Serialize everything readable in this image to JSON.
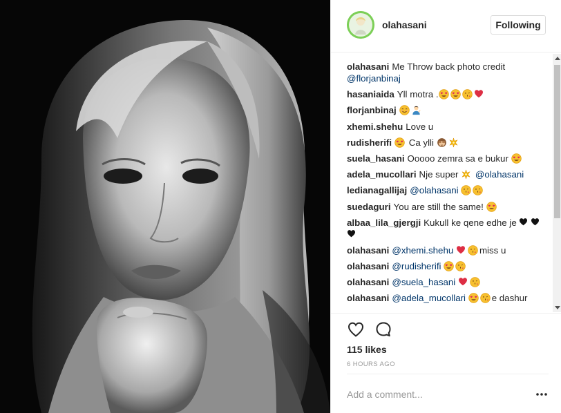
{
  "header": {
    "username": "olahasani",
    "follow_label": "Following"
  },
  "comments": [
    {
      "user": "olahasani",
      "parts": [
        {
          "t": "text",
          "v": "Me Throw back photo credit "
        },
        {
          "t": "mention",
          "v": "@florjanbinaj"
        }
      ]
    },
    {
      "user": "hasaniaida",
      "parts": [
        {
          "t": "text",
          "v": "Yll motra ."
        },
        {
          "t": "emoji",
          "v": "heart-eyes"
        },
        {
          "t": "emoji",
          "v": "heart-eyes"
        },
        {
          "t": "emoji",
          "v": "kiss"
        },
        {
          "t": "emoji",
          "v": "heart"
        }
      ]
    },
    {
      "user": "florjanbinaj",
      "parts": [
        {
          "t": "emoji",
          "v": "smile"
        },
        {
          "t": "emoji",
          "v": "person-tipping-hand"
        }
      ]
    },
    {
      "user": "xhemi.shehu",
      "parts": [
        {
          "t": "text",
          "v": "Love u"
        }
      ]
    },
    {
      "user": "rudisherifi",
      "parts": [
        {
          "t": "emoji",
          "v": "heart-eyes"
        },
        {
          "t": "text",
          "v": " Ca ylli "
        },
        {
          "t": "emoji",
          "v": "see-no-evil-monkey"
        },
        {
          "t": "emoji",
          "v": "sparkle"
        }
      ]
    },
    {
      "user": "suela_hasani",
      "parts": [
        {
          "t": "text",
          "v": "Ooooo zemra sa e bukur "
        },
        {
          "t": "emoji",
          "v": "heart-eyes"
        }
      ]
    },
    {
      "user": "adela_mucollari",
      "parts": [
        {
          "t": "text",
          "v": "Nje super "
        },
        {
          "t": "emoji",
          "v": "sparkle"
        },
        {
          "t": "text",
          "v": " "
        },
        {
          "t": "mention",
          "v": "@olahasani"
        }
      ]
    },
    {
      "user": "ledianagallijaj",
      "parts": [
        {
          "t": "mention",
          "v": "@olahasani"
        },
        {
          "t": "text",
          "v": " "
        },
        {
          "t": "emoji",
          "v": "kiss"
        },
        {
          "t": "emoji",
          "v": "kiss"
        }
      ]
    },
    {
      "user": "suedaguri",
      "parts": [
        {
          "t": "text",
          "v": "You are still the same! "
        },
        {
          "t": "emoji",
          "v": "heart-eyes"
        }
      ]
    },
    {
      "user": "albaa_lila_gjergji",
      "parts": [
        {
          "t": "text",
          "v": "Kukull ke qene edhe je "
        },
        {
          "t": "emoji",
          "v": "black-heart"
        },
        {
          "t": "emoji",
          "v": "black-heart"
        },
        {
          "t": "emoji",
          "v": "black-heart"
        }
      ]
    },
    {
      "user": "olahasani",
      "parts": [
        {
          "t": "mention",
          "v": "@xhemi.shehu"
        },
        {
          "t": "text",
          "v": " "
        },
        {
          "t": "emoji",
          "v": "heart"
        },
        {
          "t": "emoji",
          "v": "kiss"
        },
        {
          "t": "text",
          "v": "miss u"
        }
      ]
    },
    {
      "user": "olahasani",
      "parts": [
        {
          "t": "mention",
          "v": "@rudisherifi"
        },
        {
          "t": "text",
          "v": " "
        },
        {
          "t": "emoji",
          "v": "heart-eyes"
        },
        {
          "t": "emoji",
          "v": "kiss"
        }
      ]
    },
    {
      "user": "olahasani",
      "parts": [
        {
          "t": "mention",
          "v": "@suela_hasani"
        },
        {
          "t": "text",
          "v": " "
        },
        {
          "t": "emoji",
          "v": "heart"
        },
        {
          "t": "emoji",
          "v": "kiss"
        }
      ]
    },
    {
      "user": "olahasani",
      "parts": [
        {
          "t": "mention",
          "v": "@adela_mucollari"
        },
        {
          "t": "text",
          "v": " "
        },
        {
          "t": "emoji",
          "v": "heart-eyes"
        },
        {
          "t": "emoji",
          "v": "kiss"
        },
        {
          "t": "text",
          "v": "e dashur"
        }
      ]
    }
  ],
  "actions": {
    "like_icon": "heart-outline-icon",
    "comment_icon": "speech-bubble-icon",
    "likes": "115 likes",
    "time": "6 HOURS AGO"
  },
  "add_comment": {
    "placeholder": "Add a comment...",
    "more_icon": "more-options-icon"
  },
  "colors": {
    "text": "#262626",
    "mention": "#003569",
    "muted": "#999999",
    "border": "#efefef",
    "heart_red": "#e0245e"
  }
}
